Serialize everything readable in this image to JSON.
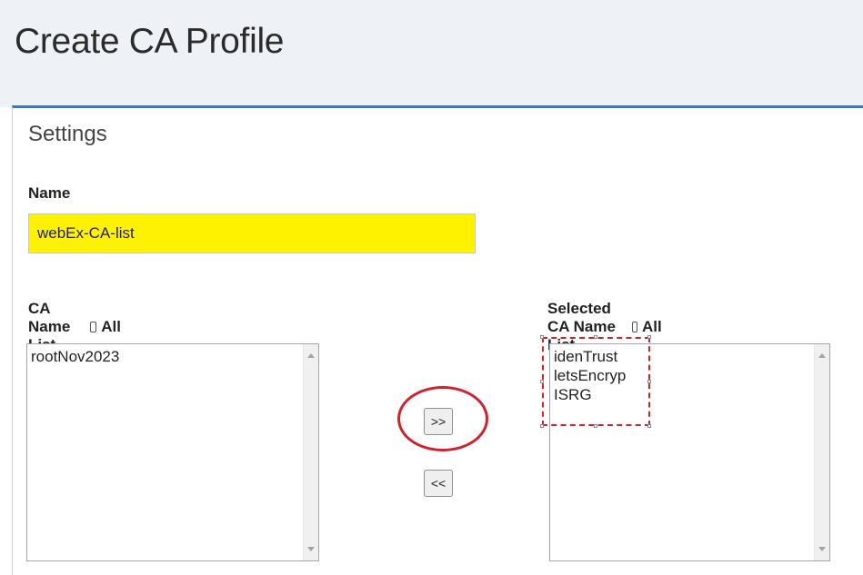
{
  "page": {
    "title": "Create CA Profile"
  },
  "settings": {
    "section_title": "Settings",
    "name_label": "Name",
    "name_value": "webEx-CA-list",
    "ca_list_label": "CA Name List",
    "ca_all_label": "All",
    "selected_list_label": "Selected CA Name List",
    "selected_all_label": "All",
    "ca_items": [
      "rootNov2023"
    ],
    "selected_items": [
      "idenTrust",
      "letsEncryp",
      "ISRG"
    ],
    "add_button_label": ">>",
    "remove_button_label": "<<"
  },
  "annotations": {
    "highlight_color": "#d3202a"
  },
  "colors": {
    "header_bg": "#eef1f6",
    "panel_accent": "#3c79bd",
    "name_field_bg": "#fff200"
  },
  "icons": {
    "scroll_up": "chevron-up-icon",
    "scroll_down": "chevron-down-icon"
  }
}
